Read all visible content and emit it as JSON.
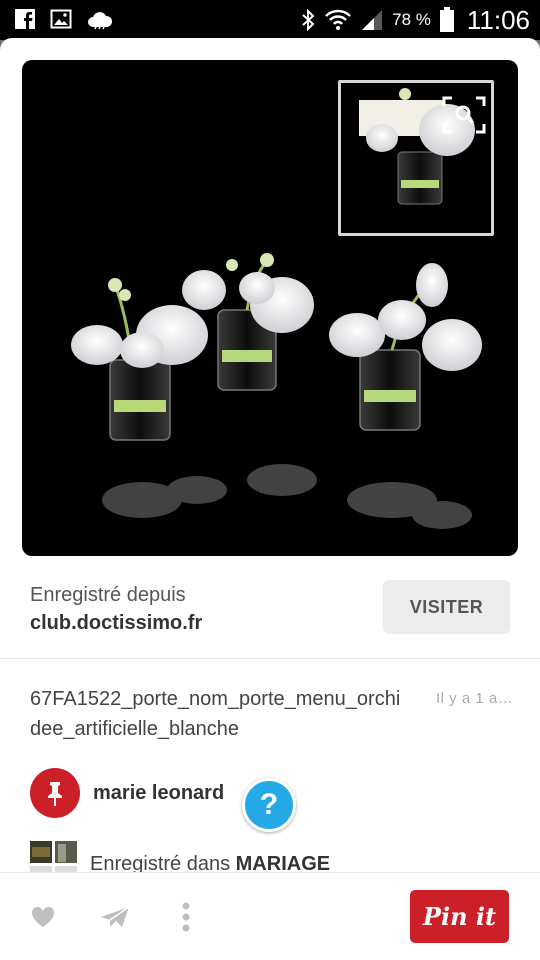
{
  "status_bar": {
    "battery_percent": "78 %",
    "time": "11:06",
    "icons": [
      "facebook-icon",
      "gallery-icon",
      "weather-cloud-icon",
      "bluetooth-icon",
      "wifi-icon",
      "signal-icon",
      "battery-icon"
    ]
  },
  "pin": {
    "image_alt_icon": "orchid-photo",
    "zoom_icon": "visual-search-icon"
  },
  "source": {
    "saved_from_label": "Enregistré depuis",
    "domain": "club.doctissimo.fr",
    "visit_label": "VISITER"
  },
  "description": "67FA1522_porte_nom_porte_menu_orchidee_artificielle_blanche",
  "time_ago": "Il y a 1 a…",
  "pinner": {
    "name": "marie leonard"
  },
  "help_label": "?",
  "board": {
    "prefix": "Enregistré dans ",
    "name": "MARIAGE"
  },
  "actions": {
    "like_icon": "heart-icon",
    "send_icon": "send-icon",
    "more_icon": "more-vertical-icon",
    "pinit_label": "Pin it"
  },
  "colors": {
    "pinterest_red": "#cb2027",
    "help_blue": "#24a9e6"
  }
}
